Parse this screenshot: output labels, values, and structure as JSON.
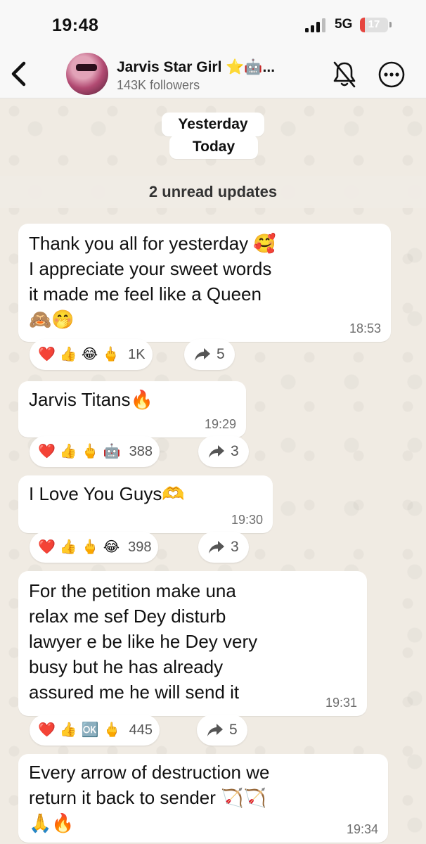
{
  "status_bar": {
    "time": "19:48",
    "network": "5G",
    "battery": "17",
    "battery_level": 0.17,
    "battery_color": "#e6453f"
  },
  "header": {
    "channel_name": "Jarvis Star Girl ⭐🤖...",
    "followers": "143K followers",
    "back_icon": "chevron-left-icon",
    "mute_icon": "bell-muted-icon",
    "more_icon": "more-icon"
  },
  "date_pills": {
    "yesterday": "Yesterday",
    "today": "Today"
  },
  "unread_banner": "2 unread updates",
  "messages": [
    {
      "text": "Thank you all for yesterday 🥰\nI appreciate your sweet words\nit made me feel like a Queen\n🙈🤭",
      "time": "18:53",
      "reactions": [
        "❤️",
        "👍",
        "😂",
        "🖕"
      ],
      "reaction_count": "1K",
      "forwards": "5"
    },
    {
      "text": "Jarvis Titans🔥",
      "time": "19:29",
      "reactions": [
        "❤️",
        "👍",
        "🖕",
        "🤖"
      ],
      "reaction_count": "388",
      "forwards": "3"
    },
    {
      "text": "I Love You Guys🫶",
      "time": "19:30",
      "reactions": [
        "❤️",
        "👍",
        "🖕",
        "😂"
      ],
      "reaction_count": "398",
      "forwards": "3"
    },
    {
      "text": "For the petition make una\nrelax me sef Dey disturb\nlawyer e be like he Dey very\nbusy but he has already\nassured me he will send it",
      "time": "19:31",
      "reactions": [
        "❤️",
        "👍",
        "🆗",
        "🖕"
      ],
      "reaction_count": "445",
      "forwards": "5"
    },
    {
      "text": "Every arrow of destruction we\nreturn it back to sender 🏹🏹\n🙏🔥",
      "time": "19:34"
    }
  ]
}
